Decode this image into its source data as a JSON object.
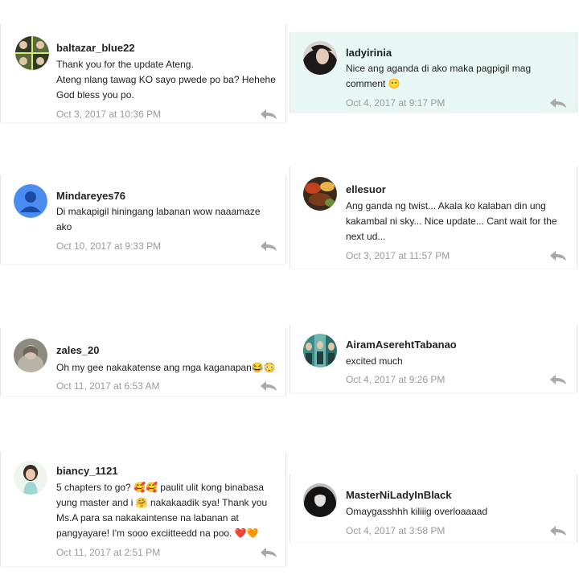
{
  "comments": [
    {
      "username": "baltazar_blue22",
      "lines": [
        "Thank you for the update Ateng.",
        "Ateng nlang tawag KO sayo pwede po ba? Hehehe",
        "God bless you po."
      ],
      "timestamp": "Oct 3, 2017 at 10:36 PM",
      "avatar_icon": "collage-avatar-icon",
      "highlighted": false
    },
    {
      "username": "ladyirinia",
      "lines": [
        "Nice ang aganda di ako maka pagpigil mag",
        "comment 😶"
      ],
      "timestamp": "Oct 4, 2017 at 9:17 PM",
      "avatar_icon": "dark-hair-avatar-icon",
      "highlighted": true,
      "highlight_color": "#e8f7f3"
    },
    {
      "username": "Mindareyes76",
      "lines": [
        "Di makapigil hiningang labanan  wow naaamaze",
        "ako"
      ],
      "timestamp": "Oct 10, 2017 at 9:33 PM",
      "avatar_icon": "default-user-avatar-icon",
      "highlighted": false
    },
    {
      "username": "ellesuor",
      "lines": [
        "Ang ganda ng twist... Akala ko kalaban din ung",
        "kakambal ni sky... Nice update... Cant wait for the",
        "next ud..."
      ],
      "timestamp": "Oct 3, 2017 at 11:57 PM",
      "avatar_icon": "food-avatar-icon",
      "highlighted": false
    },
    {
      "username": "zales_20",
      "lines": [
        "Oh my gee nakakatense ang mga kaganapan😂😳"
      ],
      "timestamp": "Oct 11, 2017 at 6:53 AM",
      "avatar_icon": "photo-avatar-icon",
      "highlighted": false
    },
    {
      "username": "AiramAserehtTabanao",
      "lines": [
        "excited much"
      ],
      "timestamp": "Oct 4, 2017 at 9:26 PM",
      "avatar_icon": "teal-collage-avatar-icon",
      "highlighted": false
    },
    {
      "username": "biancy_1121",
      "lines": [
        "5 chapters to go? 🥰🥰 paulit ulit kong binabasa",
        "yung master and i 🤗 nakakaadik sya! Thank you",
        "Ms.A para sa nakakaintense na labanan at",
        "pangyayare! I'm sooo exciitteedd na poo. ❤️🧡"
      ],
      "timestamp": "Oct 11, 2017 at 2:51 PM",
      "avatar_icon": "girl-avatar-icon",
      "highlighted": false
    },
    {
      "username": "MasterNiLadyInBlack",
      "lines": [
        "Omaygasshhh kiliiig overloaaaad"
      ],
      "timestamp": "Oct 4, 2017 at 3:58 PM",
      "avatar_icon": "black-hair-avatar-icon",
      "highlighted": false
    }
  ],
  "colors": {
    "timestamp": "#9a9a9a",
    "reply_icon": "#a8a8a8",
    "default_avatar": "#4a8df0"
  },
  "reply_icon": "reply-arrow-icon"
}
